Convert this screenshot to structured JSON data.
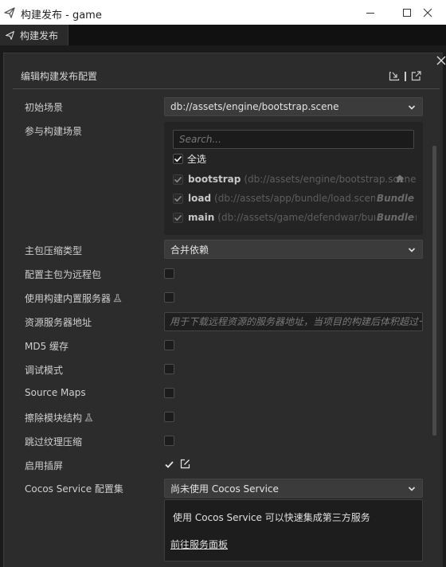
{
  "window": {
    "title": "构建发布 - game",
    "icon": "paper-plane-icon"
  },
  "tab": {
    "label": "构建发布",
    "icon": "paper-plane-icon"
  },
  "panel": {
    "title": "编辑构建发布配置",
    "header_icons": [
      "import-icon",
      "export-icon"
    ]
  },
  "fields": {
    "start_scene": {
      "label": "初始场景",
      "value": "db://assets/engine/bootstrap.scene"
    },
    "scenes": {
      "label": "参与构建场景",
      "search_placeholder": "Search...",
      "select_all_label": "全选",
      "select_all_checked": true,
      "items": [
        {
          "name": "bootstrap",
          "path": "(db://assets/engine/bootstrap.scene)",
          "tag": "",
          "icon": "home-icon",
          "checked": true
        },
        {
          "name": "load",
          "path": "(db://assets/app/bundle/load.scene)",
          "tag": "Bundle",
          "checked": true
        },
        {
          "name": "main",
          "path": "(db://assets/game/defendwar/bundle/main.scene)",
          "tag": "Bundle",
          "checked": true
        }
      ]
    },
    "main_bundle_compression": {
      "label": "主包压缩类型",
      "value": "合并依赖"
    },
    "main_bundle_remote": {
      "label": "配置主包为远程包",
      "checked": false
    },
    "builtin_server": {
      "label": "使用构建内置服务器",
      "experimental": true,
      "checked": false
    },
    "resource_server": {
      "label": "资源服务器地址",
      "placeholder": "用于下载远程资源的服务器地址，当项目的构建后体积超过一定大小时需要配置"
    },
    "md5_cache": {
      "label": "MD5 缓存",
      "checked": false
    },
    "debug_mode": {
      "label": "调试模式",
      "checked": false
    },
    "source_maps": {
      "label": "Source Maps",
      "checked": false
    },
    "erase_module_structure": {
      "label": "擦除模块结构",
      "experimental": true,
      "checked": false
    },
    "skip_texture_compression": {
      "label": "跳过纹理压缩",
      "checked": false
    },
    "splash_screen": {
      "label": "启用插屏",
      "checked": true
    },
    "cocos_service": {
      "label": "Cocos Service 配置集",
      "value": "尚未使用 Cocos Service",
      "description": "使用 Cocos Service 可以快速集成第三方服务",
      "link": "前往服务面板"
    }
  }
}
